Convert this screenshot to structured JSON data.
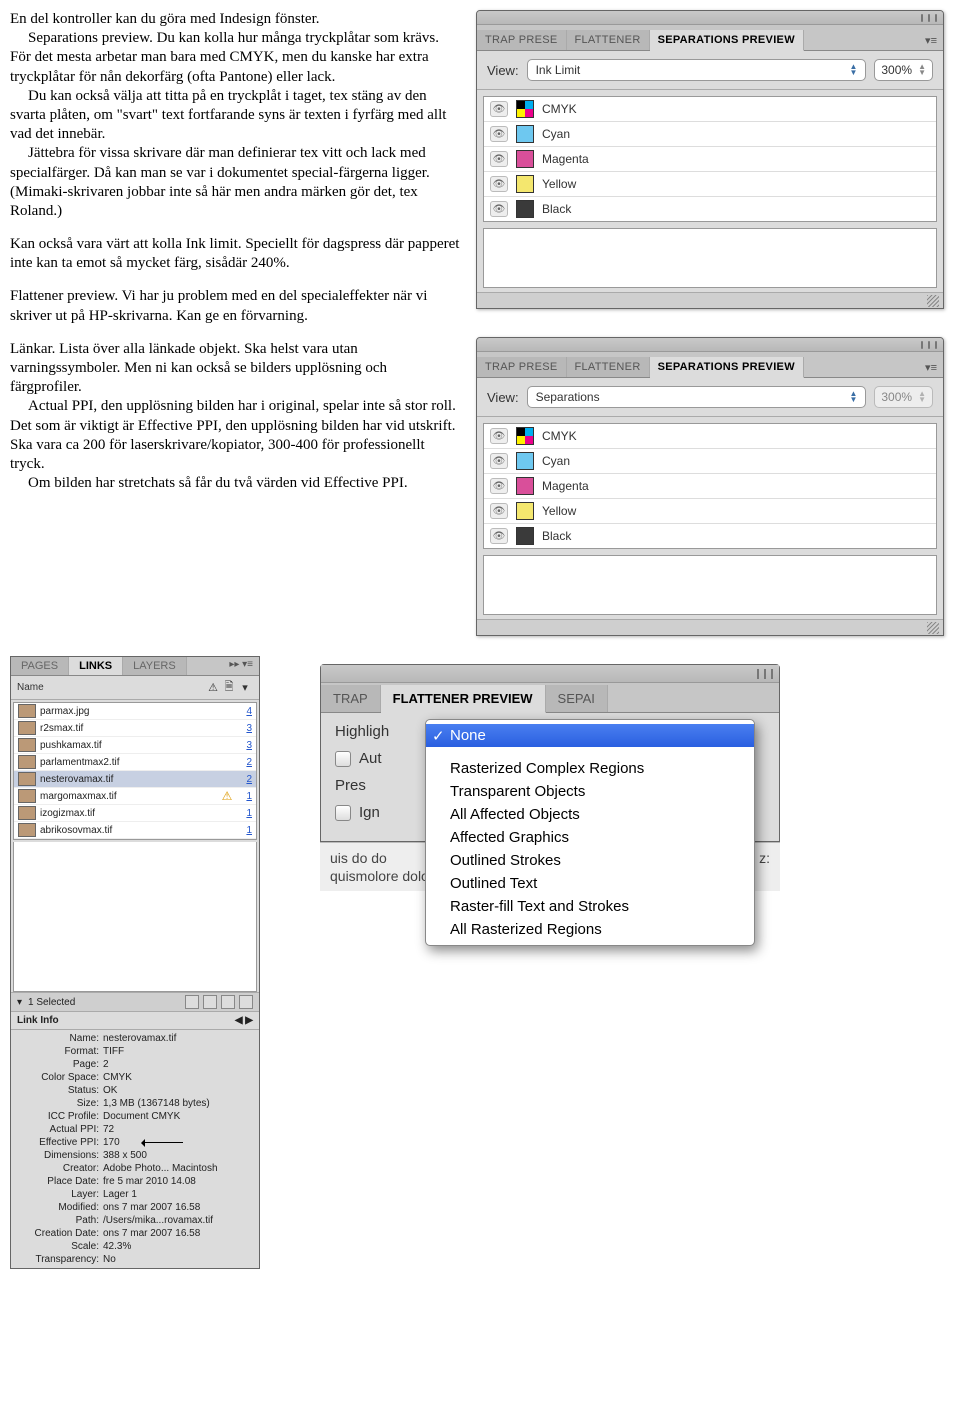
{
  "article": {
    "p1": "En del kontroller kan du göra med Indesign fönster.",
    "p2": "Separations preview. Du kan kolla hur många tryckplåtar som krävs. För det mesta arbetar man bara med CMYK, men du kanske har extra tryckplåtar för nån dekorfärg (ofta Pantone) eller lack.",
    "p3": "Du kan också välja att titta på en tryckplåt i taget, tex stäng av den svarta plåten, om \"svart\" text fortfarande syns är texten i fyrfärg med allt vad det innebär.",
    "p4": "Jättebra för vissa skrivare där man definierar tex vitt och lack med specialfärger. Då kan man se var i dokumentet special-färgerna ligger. (Mimaki-skrivaren jobbar inte så här men andra märken gör det, tex Roland.)",
    "p5": "Kan också vara värt att kolla Ink limit. Speciellt för dagspress där papperet inte kan ta emot så mycket färg, sisådär 240%.",
    "p6": "Flattener preview. Vi har ju problem med en del specialeffekter när vi skriver ut på HP-skrivarna. Kan ge en förvarning.",
    "p7": "Länkar. Lista över alla länkade objekt. Ska helst vara utan varningssymboler. Men ni kan också se bilders upplösning och färgprofiler.",
    "p8": "Actual PPI, den upplösning bilden har i original, spelar inte så stor roll. Det som är viktigt är Effective PPI, den upplösning bilden har vid utskrift. Ska vara ca 200 för laserskrivare/kopiator, 300-400 för professionellt tryck.",
    "p9": "Om bilden har stretchats så får du två värden vid Effective PPI."
  },
  "sep_panel": {
    "tabs": [
      "TRAP PRESE",
      "FLATTENER",
      "SEPARATIONS PREVIEW"
    ],
    "view_label": "View:",
    "p1": {
      "view": "Ink Limit",
      "pct": "300%"
    },
    "p2": {
      "view": "Separations",
      "pct": "300%"
    },
    "inks": [
      {
        "name": "CMYK",
        "swatch": "cmyk"
      },
      {
        "name": "Cyan",
        "swatch": "cyan"
      },
      {
        "name": "Magenta",
        "swatch": "magenta"
      },
      {
        "name": "Yellow",
        "swatch": "yellow"
      },
      {
        "name": "Black",
        "swatch": "black"
      }
    ]
  },
  "links_panel": {
    "tabs": [
      "PAGES",
      "LINKS",
      "LAYERS"
    ],
    "name_header": "Name",
    "files": [
      {
        "name": "parmax.jpg",
        "warn": "",
        "page": "4"
      },
      {
        "name": "r2smax.tif",
        "warn": "",
        "page": "3"
      },
      {
        "name": "pushkamax.tif",
        "warn": "",
        "page": "3"
      },
      {
        "name": "parlamentmax2.tif",
        "warn": "",
        "page": "2"
      },
      {
        "name": "nesterovamax.tif",
        "warn": "",
        "page": "2",
        "selected": true
      },
      {
        "name": "margomaxmax.tif",
        "warn": "⚠",
        "page": "1"
      },
      {
        "name": "izogizmax.tif",
        "warn": "",
        "page": "1"
      },
      {
        "name": "abrikosovmax.tif",
        "warn": "",
        "page": "1"
      }
    ],
    "selected_label": "1 Selected",
    "info_header": "Link Info",
    "info": [
      {
        "k": "Name:",
        "v": "nesterovamax.tif"
      },
      {
        "k": "Format:",
        "v": "TIFF"
      },
      {
        "k": "Page:",
        "v": "2"
      },
      {
        "k": "Color Space:",
        "v": "CMYK"
      },
      {
        "k": "Status:",
        "v": "OK"
      },
      {
        "k": "Size:",
        "v": "1,3 MB (1367148 bytes)"
      },
      {
        "k": "ICC Profile:",
        "v": "Document CMYK"
      },
      {
        "k": "Actual PPI:",
        "v": "72"
      },
      {
        "k": "Effective PPI:",
        "v": "170",
        "eff": true
      },
      {
        "k": "Dimensions:",
        "v": "388 x 500"
      },
      {
        "k": "Creator:",
        "v": "Adobe Photo... Macintosh"
      },
      {
        "k": "Place Date:",
        "v": "fre 5 mar 2010 14.08"
      },
      {
        "k": "Layer:",
        "v": "Lager 1"
      },
      {
        "k": "Modified:",
        "v": "ons 7 mar 2007 16.58"
      },
      {
        "k": "Path:",
        "v": "/Users/mika...rovamax.tif"
      },
      {
        "k": "Creation Date:",
        "v": "ons 7 mar 2007 16.58"
      },
      {
        "k": "Scale:",
        "v": "42.3%"
      },
      {
        "k": "Transparency:",
        "v": "No"
      }
    ]
  },
  "flat_panel": {
    "tabs": [
      "TRAP",
      "FLATTENER PREVIEW",
      "SEPAI"
    ],
    "rows": {
      "highlight": "Highligh",
      "auto": "Aut",
      "preset": "Pres",
      "ignore": "Ign"
    },
    "menu": {
      "selected": "None",
      "items": [
        "Rasterized Complex Regions",
        "Transparent Objects",
        "All Affected Objects",
        "Affected Graphics",
        "Outlined Strokes",
        "Outlined Text",
        "Raster-fill Text and Strokes",
        "All Rasterized Regions"
      ]
    },
    "greek1": "uis do do",
    "greek2": "quismolore dolor"
  }
}
